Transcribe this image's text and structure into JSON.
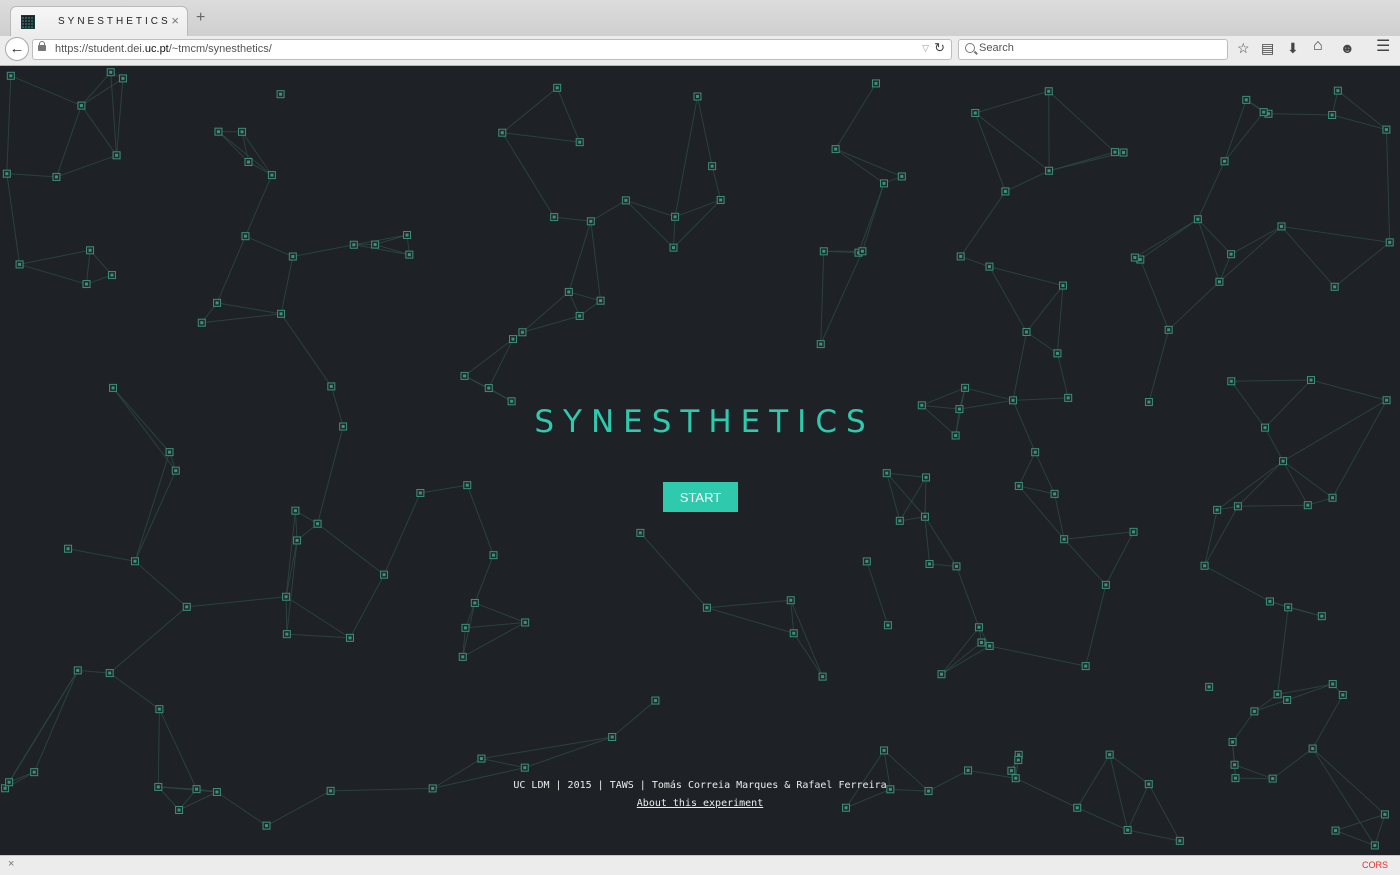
{
  "browser": {
    "tab": {
      "title": "SYNESTHETICS",
      "close_glyph": "×"
    },
    "new_tab_glyph": "+",
    "back_glyph": "←",
    "url": {
      "prefix": "https://student.dei.",
      "host_highlight": "uc.pt",
      "path": "/~tmcm/synesthetics/"
    },
    "search": {
      "placeholder": "Search"
    },
    "toolbar_icons": [
      "bookmark-star-icon",
      "reading-list-icon",
      "download-icon",
      "home-icon",
      "account-icon",
      "menu-icon"
    ],
    "toolbar_glyphs": {
      "bookmark": "☆",
      "reading": "▤",
      "download": "⬇",
      "home": "⌂",
      "account": "☻",
      "menu": "☰"
    },
    "status": {
      "close_glyph": "×",
      "badge": "CORS"
    }
  },
  "page": {
    "title": "SYNESTHETICS",
    "start_label": "START",
    "credits": "UC LDM | 2015 | TAWS | Tomás Correia Marques & Rafael Ferreira",
    "about_link": "About this experiment"
  },
  "colors": {
    "background": "#1e2125",
    "accent": "#2fc9ad",
    "node": "#3e8f7d",
    "edge": "#2d4a45"
  }
}
